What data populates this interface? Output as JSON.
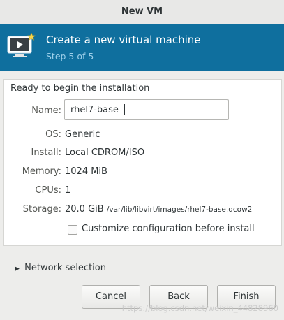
{
  "window": {
    "title": "New VM"
  },
  "banner": {
    "icon": "monitor-play-icon",
    "title": "Create a new virtual machine",
    "step": "Step 5 of 5"
  },
  "summary": {
    "heading": "Ready to begin the installation",
    "name_label": "Name:",
    "name_value": "rhel7-base",
    "os_label": "OS:",
    "os_value": "Generic",
    "install_label": "Install:",
    "install_value": "Local CDROM/ISO",
    "memory_label": "Memory:",
    "memory_value": "1024 MiB",
    "cpus_label": "CPUs:",
    "cpus_value": "1",
    "storage_label": "Storage:",
    "storage_value": "20.0 GiB",
    "storage_path": "/var/lib/libvirt/images/rhel7-base.qcow2",
    "customize_label": "Customize configuration before install",
    "customize_checked": false
  },
  "network": {
    "label": "Network selection",
    "expanded": false
  },
  "buttons": {
    "cancel": "Cancel",
    "back": "Back",
    "finish": "Finish"
  },
  "watermark": "https://blog.csdn.net/weixin_44828960",
  "colors": {
    "banner": "#0f6f9e",
    "banner_step": "#9fd0ea"
  }
}
